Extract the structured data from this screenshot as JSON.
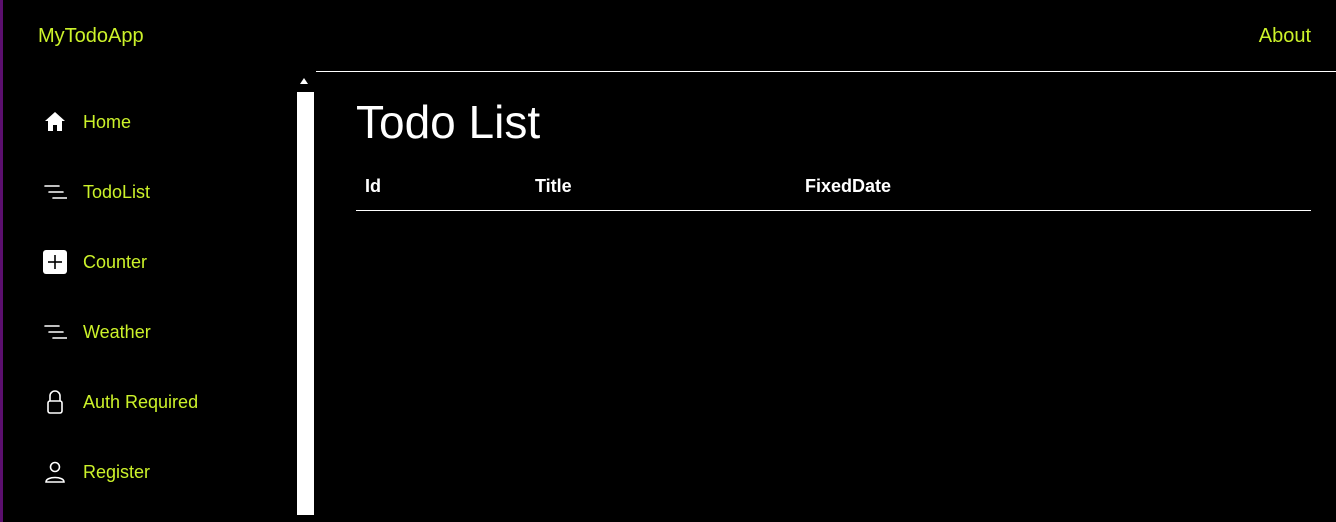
{
  "header": {
    "brand": "MyTodoApp",
    "about": "About"
  },
  "sidebar": {
    "items": [
      {
        "label": "Home",
        "icon": "home-icon"
      },
      {
        "label": "TodoList",
        "icon": "list-icon"
      },
      {
        "label": "Counter",
        "icon": "plus-square-icon"
      },
      {
        "label": "Weather",
        "icon": "list-icon"
      },
      {
        "label": "Auth Required",
        "icon": "lock-icon"
      },
      {
        "label": "Register",
        "icon": "person-icon"
      }
    ]
  },
  "main": {
    "title": "Todo List",
    "table": {
      "columns": [
        "Id",
        "Title",
        "FixedDate"
      ],
      "rows": []
    }
  },
  "colors": {
    "background": "#000000",
    "accent": "#ccf22a",
    "text": "#ffffff",
    "edge": "#5b0f6e"
  }
}
